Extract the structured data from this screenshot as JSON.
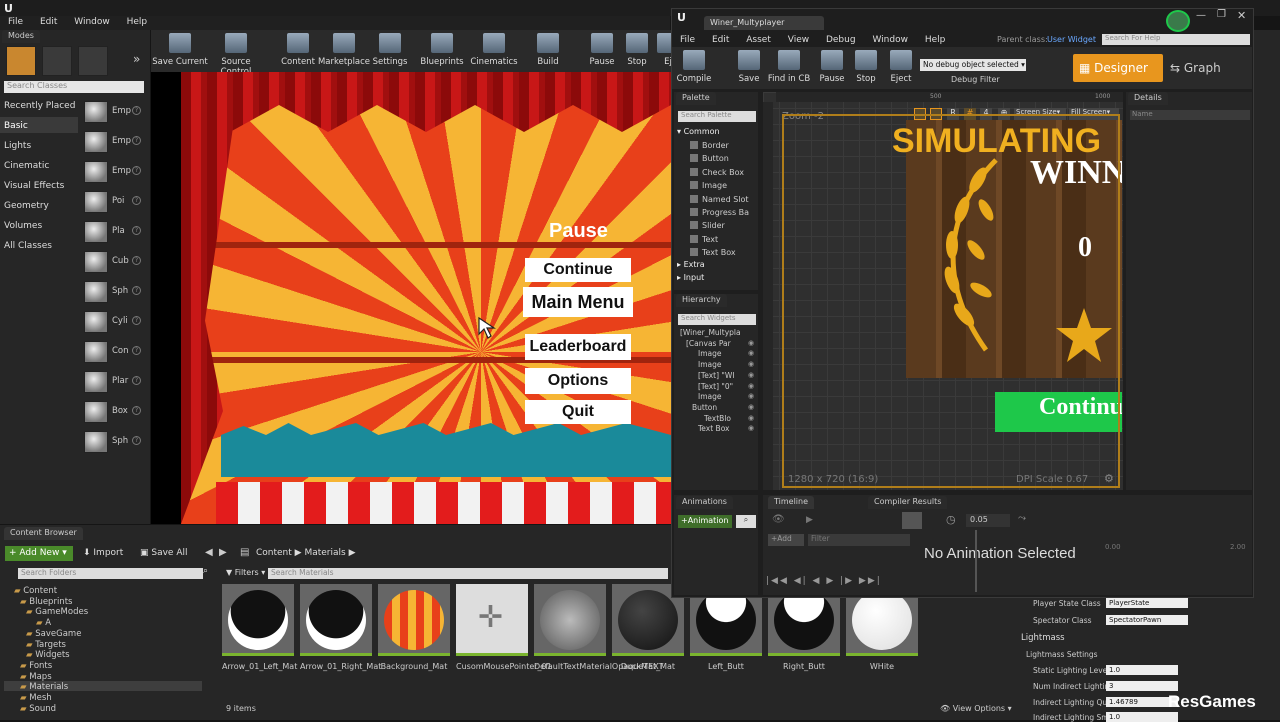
{
  "main": {
    "menu": [
      "File",
      "Edit",
      "Window",
      "Help"
    ],
    "modes_tab": "Modes",
    "toolbar": [
      {
        "label": "Save Current",
        "icon": "save-icon"
      },
      {
        "label": "Source Control",
        "icon": "source-control-icon"
      },
      {
        "label": "Content",
        "icon": "content-icon"
      },
      {
        "label": "Marketplace",
        "icon": "marketplace-icon"
      },
      {
        "label": "Settings",
        "icon": "settings-icon"
      },
      {
        "label": "Blueprints",
        "icon": "blueprints-icon"
      },
      {
        "label": "Cinematics",
        "icon": "cinematics-icon"
      },
      {
        "label": "Build",
        "icon": "build-icon"
      },
      {
        "label": "Pause",
        "icon": "pause-icon"
      },
      {
        "label": "Stop",
        "icon": "stop-icon"
      },
      {
        "label": "Ej",
        "icon": "eject-icon"
      }
    ],
    "search_classes_placeholder": "Search Classes",
    "categories": [
      "Recently Placed",
      "Basic",
      "Lights",
      "Cinematic",
      "Visual Effects",
      "Geometry",
      "Volumes",
      "All Classes"
    ],
    "place_items": [
      "Emp",
      "Emp",
      "Emp",
      "Poi",
      "Pla",
      "Cub",
      "Sph",
      "Cyli",
      "Con",
      "Plar",
      "Box",
      "Sph"
    ]
  },
  "game": {
    "pause_title": "Pause",
    "buttons": [
      "Continue",
      "Main Menu",
      "Leaderboard",
      "Options",
      "Quit"
    ]
  },
  "content_browser": {
    "tab": "Content Browser",
    "add_new": "Add New",
    "import": "Import",
    "save_all": "Save All",
    "path": [
      "Content",
      "Materials"
    ],
    "search_folders_placeholder": "Search Folders",
    "filters": "Filters",
    "search_materials_placeholder": "Search Materials",
    "tree": [
      "Content",
      "Blueprints",
      "GameModes",
      "A",
      "SaveGame",
      "Targets",
      "Widgets",
      "Fonts",
      "Maps",
      "Materials",
      "Mesh",
      "Sound"
    ],
    "assets": [
      "Arrow_01_Left_Mat",
      "Arrow_01_Right_Mat",
      "Background_Mat",
      "CusomMousePointer_01",
      "DefaultTextMaterialOpaqueTEXT",
      "DuckMat_Mat",
      "Left_Butt",
      "Right_Butt",
      "WHite"
    ],
    "item_count": "9 items",
    "view_options": "View Options"
  },
  "umg": {
    "tab_title": "Winer_Multyplayer",
    "menu": [
      "File",
      "Edit",
      "Asset",
      "View",
      "Debug",
      "Window",
      "Help"
    ],
    "parent_class_label": "Parent class:",
    "parent_class_value": "User Widget",
    "search_help_placeholder": "Search For Help",
    "toolbar": [
      "Compile",
      "Save",
      "Find in CB",
      "Pause",
      "Stop",
      "Eject"
    ],
    "debug_select": "No debug object selected",
    "debug_filter": "Debug Filter",
    "designer_label": "Designer",
    "graph_label": "Graph",
    "palette_tab": "Palette",
    "search_palette_placeholder": "Search Palette",
    "palette_common": "Common",
    "palette_items": [
      "Border",
      "Button",
      "Check Box",
      "Image",
      "Named Slot",
      "Progress Ba",
      "Slider",
      "Text",
      "Text Box"
    ],
    "palette_extra": "Extra",
    "palette_input": "Input",
    "hierarchy_tab": "Hierarchy",
    "search_widgets_placeholder": "Search Widgets",
    "hierarchy": [
      "[Winer_Multypla",
      "[Canvas Par",
      "Image",
      "Image",
      "[Text] \"WI",
      "[Text] \"0\"",
      "Image",
      "Button",
      "TextBlo",
      "Text Box"
    ],
    "ruler": [
      "500",
      "1000"
    ],
    "zoom": "Zoom -2",
    "screen_size": "Screen Size",
    "fill_screen": "Fill Screen",
    "r_label": "R",
    "grid_value": "4",
    "canvas_texts": {
      "simulating": "SIMULATING",
      "winner": "WINNE",
      "score": "0",
      "continue": "Continu"
    },
    "resolution": "1280 x 720 (16:9)",
    "dpi": "DPI Scale 0.67",
    "details_tab": "Details",
    "name_placeholder": "Name",
    "animations_tab": "Animations",
    "animation_btn": "Animation",
    "timeline_tab": "Timeline",
    "compiler_tab": "Compiler Results",
    "add_btn": "Add",
    "filter_placeholder": "Filter",
    "fps_value": "0.05",
    "no_animation": "No Animation Selected",
    "timeline_marks": [
      "0.00",
      "2.00"
    ]
  },
  "details_panel": {
    "player_state_label": "Player State Class",
    "player_state_value": "PlayerState",
    "spectator_label": "Spectator Class",
    "spectator_value": "SpectatorPawn",
    "lightmass": "Lightmass",
    "lightmass_settings": "Lightmass Settings",
    "static_lighting_label": "Static Lighting Level",
    "static_lighting_value": "1.0",
    "num_indirect_label": "Num Indirect Lighting",
    "num_indirect_value": "3",
    "indirect_quality_label": "Indirect Lighting Qua",
    "indirect_quality_value": "1.46789",
    "indirect_smooth_label": "Indirect Lighting Smo",
    "indirect_smooth_value": "1.0"
  },
  "watermark": "ResGames",
  "colors": {
    "accent_orange": "#f0a020",
    "green": "#1ec84a",
    "selection_blue": "#3a6ea5"
  }
}
